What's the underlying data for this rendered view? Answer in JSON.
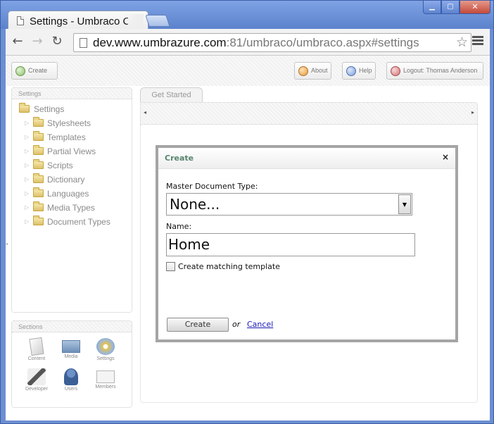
{
  "browser": {
    "tab_title": "Settings - Umbraco CMS",
    "url_host": "dev.www.umbrazure.com",
    "url_rest": ":81/umbraco/umbraco.aspx#settings",
    "window_controls": {
      "minimize": "▁",
      "maximize": "▢",
      "close": "✕"
    }
  },
  "topbar": {
    "create_label": "Create",
    "about_label": "About",
    "help_label": "Help",
    "logout_label": "Logout: Thomas Anderson"
  },
  "tree": {
    "header": "Settings",
    "root": "Settings",
    "items": [
      {
        "label": "Stylesheets"
      },
      {
        "label": "Templates"
      },
      {
        "label": "Partial Views"
      },
      {
        "label": "Scripts"
      },
      {
        "label": "Dictionary"
      },
      {
        "label": "Languages"
      },
      {
        "label": "Media Types"
      },
      {
        "label": "Document Types"
      }
    ]
  },
  "sections": {
    "header": "Sections",
    "items": [
      {
        "label": "Content",
        "icon": "content-icon"
      },
      {
        "label": "Media",
        "icon": "media-icon"
      },
      {
        "label": "Settings",
        "icon": "settings-icon"
      },
      {
        "label": "Developer",
        "icon": "developer-icon"
      },
      {
        "label": "Users",
        "icon": "users-icon"
      },
      {
        "label": "Members",
        "icon": "members-icon"
      }
    ]
  },
  "content": {
    "tab_label": "Get Started"
  },
  "modal": {
    "title": "Create",
    "close": "×",
    "master_type_label": "Master Document Type:",
    "master_type_value": "None...",
    "name_label": "Name:",
    "name_value": "Home",
    "checkbox_label": "Create matching template",
    "checkbox_checked": false,
    "create_button": "Create",
    "or_text": "or",
    "cancel_link": "Cancel"
  }
}
